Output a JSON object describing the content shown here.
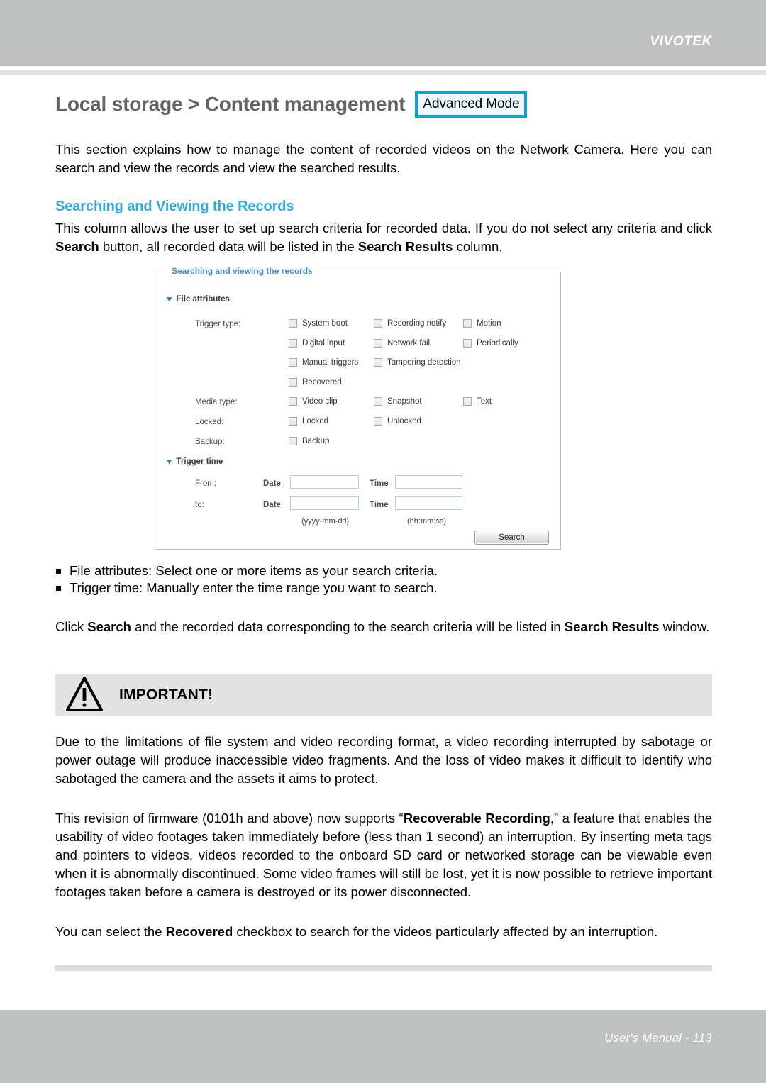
{
  "header": {
    "brand": "VIVOTEK"
  },
  "title": {
    "text": "Local storage > Content management",
    "badge": "Advanced Mode"
  },
  "intro": "This section explains how to manage the content of recorded videos on the Network Camera. Here you can search and view the records and view the searched results.",
  "section": {
    "heading": "Searching and Viewing the Records",
    "para_a": "This column allows the user to set up search criteria for recorded data. If you do not select any criteria and click ",
    "para_b": "Search",
    "para_c": " button, all recorded data will be listed in the ",
    "para_d": "Search Results",
    "para_e": " column."
  },
  "panel": {
    "legend": "Searching and viewing the records",
    "group_file_attributes": "File attributes",
    "group_trigger_time": "Trigger time",
    "labels": {
      "trigger_type": "Trigger type:",
      "media_type": "Media type:",
      "locked": "Locked:",
      "backup": "Backup:",
      "from": "From:",
      "to": "to:",
      "date": "Date",
      "time": "Time"
    },
    "trigger_type_options": [
      "System boot",
      "Recording notify",
      "Motion",
      "Digital input",
      "Network fail",
      "Periodically",
      "Manual triggers",
      "Tampering detection",
      "Recovered"
    ],
    "media_type_options": [
      "Video clip",
      "Snapshot",
      "Text"
    ],
    "locked_options": [
      "Locked",
      "Unlocked"
    ],
    "backup_options": [
      "Backup"
    ],
    "from_date_value": "",
    "from_time_value": "",
    "to_date_value": "",
    "to_time_value": "",
    "date_hint": "(yyyy-mm-dd)",
    "time_hint": "(hh:mm:ss)",
    "search_button": "Search"
  },
  "bullets": [
    "File attributes: Select one or more items as your search criteria.",
    "Trigger time: Manually enter the time range you want to search."
  ],
  "click_para": {
    "a": "Click ",
    "b": "Search",
    "c": " and the recorded data corresponding to the search criteria will be listed in ",
    "d": "Search Results",
    "e": " window."
  },
  "callout": {
    "title": "IMPORTANT!",
    "para1": "Due to the limitations of file system and video recording format, a video recording interrupted by sabotage or power outage will produce inaccessible video fragments. And the loss of video makes it difficult to identify who sabotaged the camera and the assets it aims to protect.",
    "para2_a": "This revision of firmware (0101h and above) now supports “",
    "para2_b": "Recoverable Recording",
    "para2_c": ",” a feature that enables the usability of video footages taken immediately before (less than 1 second) an interruption. By inserting meta tags and pointers to videos, videos recorded to the onboard SD card or networked storage can be viewable even when it is abnormally discontinued. Some video frames will still be lost, yet it is now possible to retrieve important footages taken before a camera is destroyed or its power disconnected.",
    "para3_a": "You can select the ",
    "para3_b": "Recovered",
    "para3_c": " checkbox to search for the videos particularly affected by an interruption."
  },
  "footer": {
    "text": "User's Manual - 113"
  },
  "colors": {
    "band_gray": "#bfc1c1",
    "accent_blue": "#2eaae2",
    "badge_border": "#0ca0e3",
    "legend_blue": "#3d8fd0",
    "title_gray": "#636363"
  }
}
